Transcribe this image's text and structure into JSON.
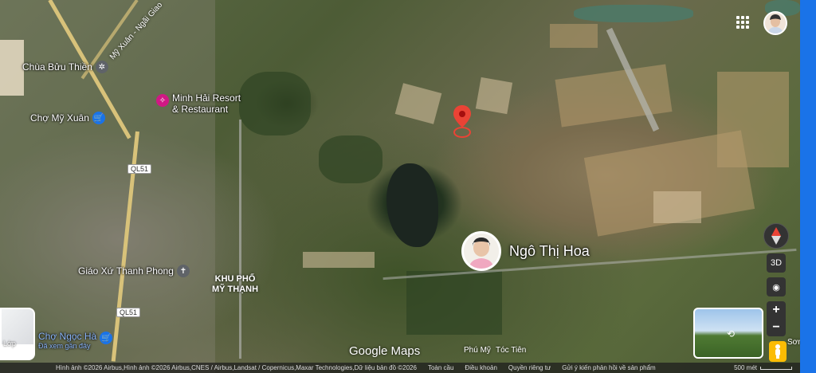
{
  "map": {
    "pois": [
      {
        "label": "Chùa Bửu Thiền",
        "icon": "temple-icon",
        "color": "#5f6368"
      },
      {
        "label": "Minh Hải Resort\n& Restaurant",
        "icon": "resort-icon",
        "color": "#d01884"
      },
      {
        "label": "Chợ Mỹ Xuân",
        "icon": "shopping-cart-icon",
        "color": "#1a73e8"
      },
      {
        "label": "Giáo Xứ Thanh Phong",
        "icon": "church-icon",
        "color": "#5f6368"
      },
      {
        "label": "Chợ Ngọc Hà",
        "sublabel": "Đã xem gần đây",
        "icon": "shopping-cart-icon",
        "color": "#1a73e8"
      }
    ],
    "area_label": "KHU PHỐ\nMỸ THẠNH",
    "road_labels": [
      "QL51",
      "QL51"
    ],
    "street_label": "Mỹ Xuân - Ngãi Giao",
    "bottom_place_labels": [
      "Phú Mỹ",
      "Tóc Tiên",
      "Sơn"
    ],
    "pin_color": "#ea4335",
    "profile_name": "Ngô Thị Hoa"
  },
  "brand": "Google Maps",
  "bottom_bar": {
    "attribution": "Hình ảnh ©2026 Airbus,Hình ảnh ©2026 Airbus,CNES / Airbus,Landsat / Copernicus,Maxar Technologies,Dữ liệu bản đồ ©2026",
    "links": [
      "Toàn cầu",
      "Điều khoản",
      "Quyền riêng tư",
      "Gửi ý kiến phản hồi về sản phẩm"
    ],
    "scale": "500 mét"
  },
  "layer_button": {
    "label": "Lớp"
  },
  "controls": {
    "tilt_label": "3D",
    "zoom_in": "+",
    "zoom_out": "−"
  },
  "accent": "#1a73e8"
}
